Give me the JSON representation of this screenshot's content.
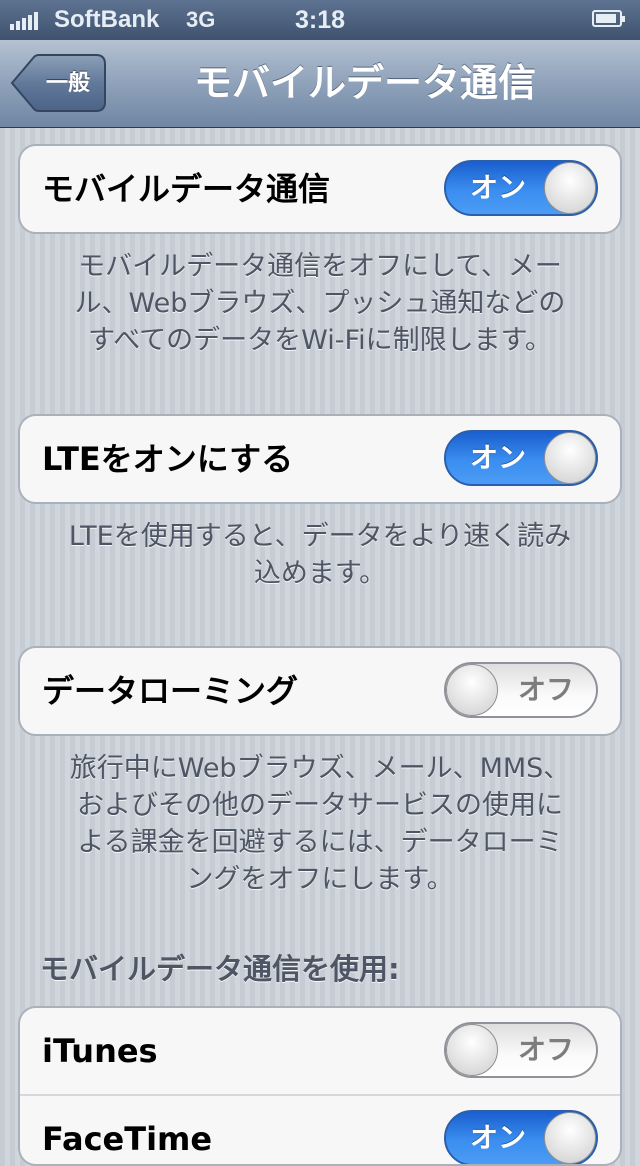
{
  "status_bar": {
    "carrier": "SoftBank",
    "network": "3G",
    "time": "3:18"
  },
  "nav": {
    "back_label": "一般",
    "title": "モバイルデータ通信"
  },
  "settings": [
    {
      "label": "モバイルデータ通信",
      "state": "オン",
      "footer": [
        "モバイルデータ通信をオフにして、メー",
        "ル、Webブラウズ、プッシュ通知などの",
        "すべてのデータをWi-Fiに制限します。"
      ]
    },
    {
      "label": "LTEをオンにする",
      "state": "オン",
      "footer": [
        "LTEを使用すると、データをより速く読み",
        "込めます。"
      ]
    },
    {
      "label": "データローミング",
      "state": "オフ",
      "footer": [
        "旅行中にWebブラウズ、メール、MMS、",
        "およびその他のデータサービスの使用に",
        "よる課金を回避するには、データローミ",
        "ングをオフにします。"
      ]
    }
  ],
  "apps_section": {
    "header": "モバイルデータ通信を使用:",
    "items": [
      {
        "label": "iTunes",
        "state": "オフ"
      },
      {
        "label": "FaceTime",
        "state": "オン"
      }
    ]
  },
  "colors": {
    "toggle_on": "#3b8eef",
    "nav_bar": "#8fa2ba",
    "background": "#cbd2d8"
  },
  "icons": {
    "back": "back-chevron-icon",
    "signal": "signal-bars-icon",
    "battery": "battery-icon"
  }
}
